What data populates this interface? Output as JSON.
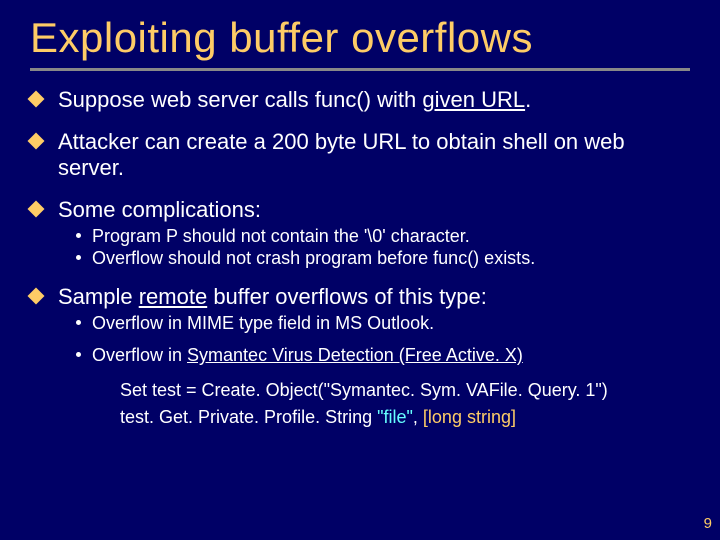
{
  "title": "Exploiting buffer overflows",
  "bullets": {
    "b1_pre": "Suppose web server calls  func()  with ",
    "b1_link": "given URL",
    "b1_post": ".",
    "b2": "Attacker can create a 200 byte URL to obtain shell on web server.",
    "b3": "Some complications:",
    "b3_sub1": "Program  P  should not contain the '\\0'  character.",
    "b3_sub2": "Overflow should not crash program before  func()  exists.",
    "b4_pre": "Sample ",
    "b4_link": "remote",
    "b4_post": " buffer overflows of this type:",
    "b4_sub1": "Overflow in MIME type field in MS Outlook.",
    "b4_sub2_pre": "Overflow in ",
    "b4_sub2_link": "Symantec Virus Detection (Free Active. X)"
  },
  "code": {
    "line1": "Set test = Create. Object(\"Symantec. Sym. VAFile. Query. 1\")",
    "line2a": "test. Get. Private. Profile. String  ",
    "line2b": "\"file\"",
    "line2c": ",  ",
    "line2d": "[long string]"
  },
  "page": "9"
}
